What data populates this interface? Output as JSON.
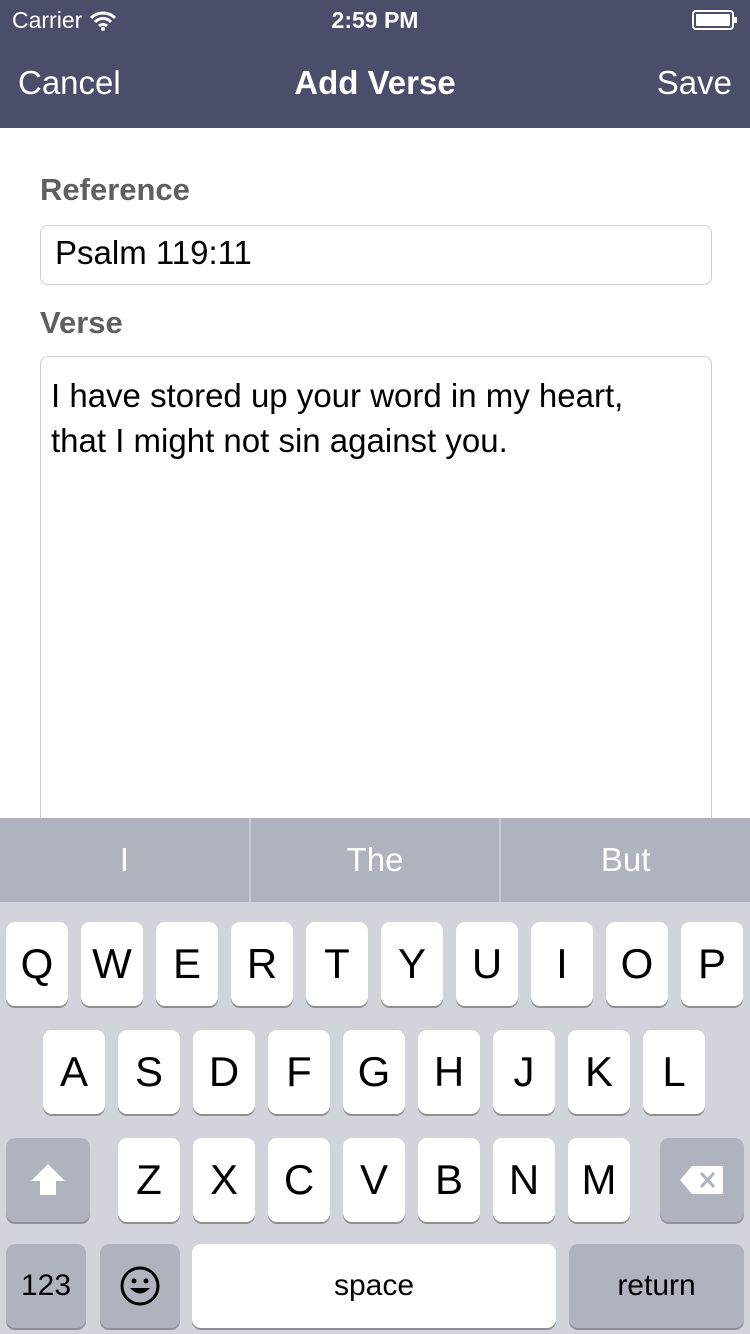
{
  "status_bar": {
    "carrier": "Carrier",
    "time": "2:59 PM"
  },
  "nav": {
    "cancel": "Cancel",
    "title": "Add Verse",
    "save": "Save"
  },
  "form": {
    "reference_label": "Reference",
    "reference_value": "Psalm 119:11",
    "verse_label": "Verse",
    "verse_line1": "I have stored up your word in my heart,",
    "verse_line2": "that I might not sin against you."
  },
  "suggestions": [
    "I",
    "The",
    "But"
  ],
  "keyboard": {
    "row1": [
      "Q",
      "W",
      "E",
      "R",
      "T",
      "Y",
      "U",
      "I",
      "O",
      "P"
    ],
    "row2": [
      "A",
      "S",
      "D",
      "F",
      "G",
      "H",
      "J",
      "K",
      "L"
    ],
    "row3": [
      "Z",
      "X",
      "C",
      "V",
      "B",
      "N",
      "M"
    ],
    "numbers_key": "123",
    "space_key": "space",
    "return_key": "return"
  }
}
